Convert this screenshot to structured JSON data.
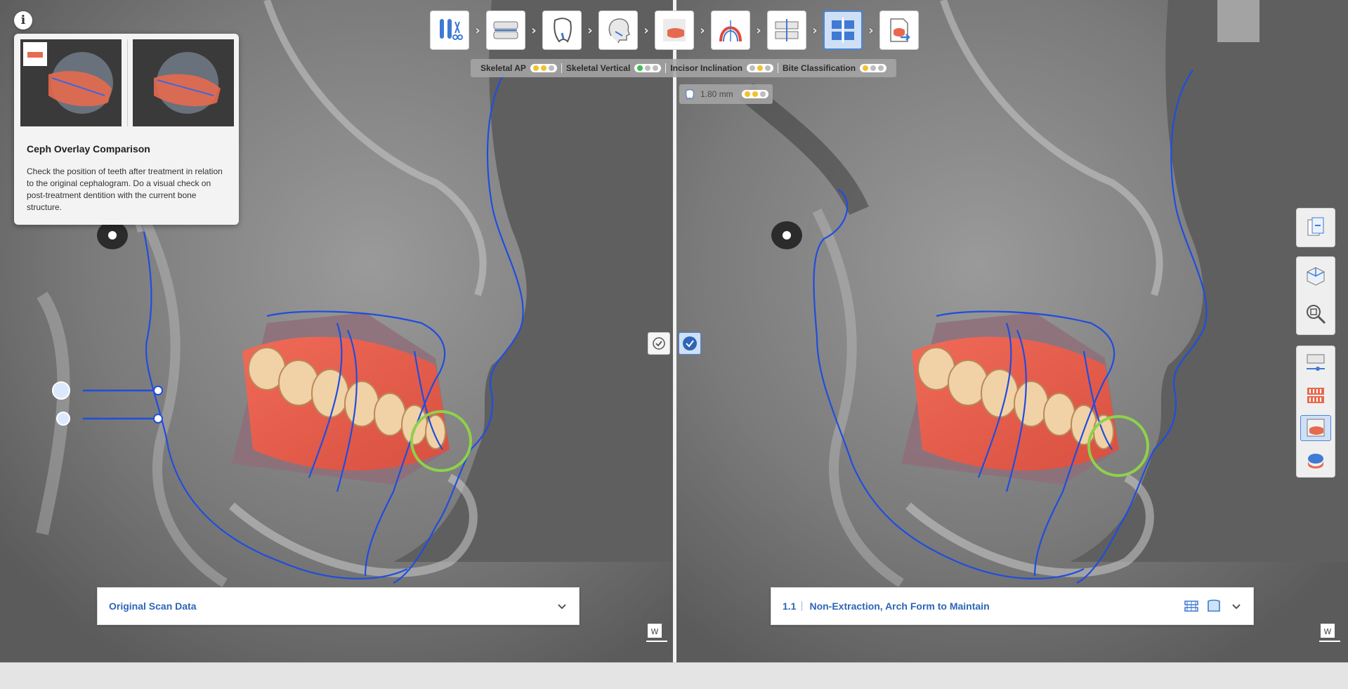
{
  "help": {
    "title": "Ceph Overlay Comparison",
    "description": "Check the position of teeth after treatment in relation to the original cephalogram. Do a visual check on post-treatment dentition with the current bone structure.",
    "info_icon": "i"
  },
  "workflow": {
    "steps": [
      {
        "name": "setup-icon",
        "active": false
      },
      {
        "name": "arch-icon",
        "active": false
      },
      {
        "name": "tooth-icon",
        "active": false
      },
      {
        "name": "ceph-head-icon",
        "active": false
      },
      {
        "name": "ceph-teeth-icon",
        "active": false
      },
      {
        "name": "arch-form-icon",
        "active": false
      },
      {
        "name": "occlusion-icon",
        "active": false
      },
      {
        "name": "comparison-icon",
        "active": true
      },
      {
        "name": "export-icon",
        "active": false
      }
    ]
  },
  "analysis": {
    "metrics": [
      {
        "label": "Skeletal AP",
        "dots": [
          "yellow",
          "yellow",
          "gray"
        ]
      },
      {
        "label": "Skeletal Vertical",
        "dots": [
          "green",
          "gray",
          "gray"
        ]
      },
      {
        "label": "Incisor Inclination",
        "dots": [
          "gray",
          "yellow",
          "gray"
        ]
      },
      {
        "label": "Bite Classification",
        "dots": [
          "yellow",
          "gray",
          "gray"
        ]
      }
    ],
    "measure_value": "1.80 mm",
    "measure_dots": [
      "yellow",
      "yellow",
      "gray"
    ]
  },
  "left_panel": {
    "dropdown_label": "Original Scan Data"
  },
  "right_panel": {
    "plan_number": "1.1",
    "dropdown_label": "Non-Extraction, Arch Form to Maintain"
  },
  "colors": {
    "accent": "#2d65b8",
    "trace": "#1f4de0",
    "highlight_circle": "#8ed14a",
    "dot_yellow": "#f0c22e",
    "dot_green": "#3cc04a",
    "dot_gray": "#bdbdbd"
  },
  "side_toolbar": {
    "groups": [
      [
        "overlay-icon"
      ],
      [
        "3d-view-icon",
        "zoom-fit-icon"
      ],
      [
        "arch-slider-icon",
        "teeth-icon",
        "ceph-overlay-icon",
        "model-base-icon"
      ]
    ],
    "active": "ceph-overlay-icon"
  }
}
